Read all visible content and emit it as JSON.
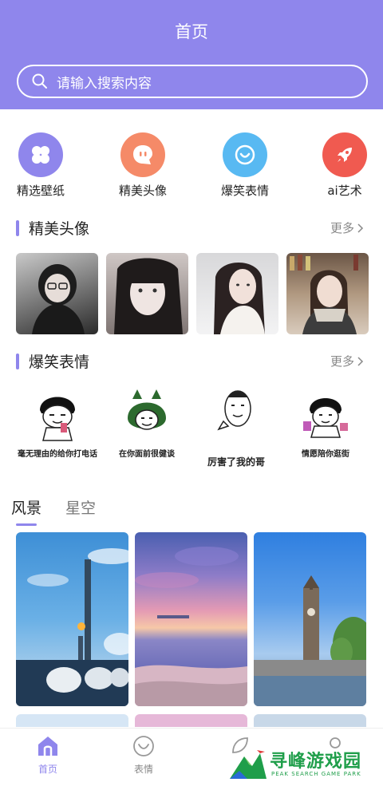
{
  "header": {
    "title": "首页",
    "search_placeholder": "请输入搜索内容",
    "background": "#8f86ec"
  },
  "categories": [
    {
      "label": "精选壁纸",
      "icon": "clover-icon",
      "color": "#8f86ec"
    },
    {
      "label": "精美头像",
      "icon": "chat-face-icon",
      "color": "#f58a68"
    },
    {
      "label": "爆笑表情",
      "icon": "smile-icon",
      "color": "#58b9f2"
    },
    {
      "label": "ai艺术",
      "icon": "rocket-icon",
      "color": "#f05a50"
    }
  ],
  "sections": {
    "avatars": {
      "title": "精美头像",
      "more": "更多"
    },
    "memes": {
      "title": "爆笑表情",
      "more": "更多"
    }
  },
  "memes": [
    {
      "caption": "毫无理由的给你打电话"
    },
    {
      "caption": "在你面前很健谈"
    },
    {
      "caption": "厉害了我的哥"
    },
    {
      "caption": "情愿陪你逛街"
    }
  ],
  "tabs": [
    {
      "label": "风景",
      "active": true
    },
    {
      "label": "星空",
      "active": false
    }
  ],
  "bottom_nav": [
    {
      "label": "首页",
      "icon": "home-icon",
      "active": true
    },
    {
      "label": "表情",
      "icon": "smile-icon",
      "active": false
    }
  ],
  "watermark": {
    "title": "寻峰游戏园",
    "subtitle": "PEAK SEARCH GAME PARK"
  },
  "accent_color": "#8f86ec"
}
